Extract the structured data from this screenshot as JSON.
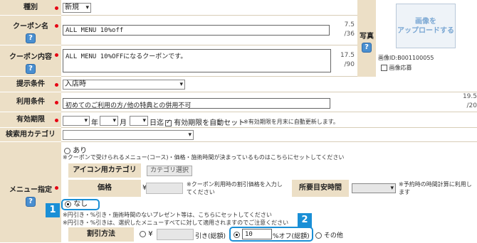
{
  "rows": {
    "type": {
      "label": "種別",
      "value": "新規"
    },
    "name": {
      "label": "クーポン名",
      "value": "ALL MENU 10%off",
      "count": "7.5",
      "max": "/36"
    },
    "content": {
      "label": "クーポン内容",
      "value": "ALL MENU 10%OFFになるクーポンです。",
      "count": "17.5",
      "max": "/90"
    },
    "condition": {
      "label": "提示条件",
      "value": "入店時"
    },
    "terms": {
      "label": "利用条件",
      "value": "初めてのご利用の方/他の特典との併用不可",
      "count": "19.5",
      "max": "/20"
    },
    "expiry": {
      "label": "有効期限",
      "year": "年",
      "month": "月",
      "day": "日迄",
      "auto_label": "有効期限を自動セット",
      "auto_note": "※有効期限を月末に自動更新します。"
    },
    "search_cat": {
      "label": "検索用カテゴリ"
    },
    "menu": {
      "label": "メニュー指定",
      "ari": "あり",
      "ari_note": "※クーポンで受けられるメニュー(コース)・価格・施術時間が決まっているものはこちらにセットしてください",
      "icon_cat_label": "アイコン用カテゴリ",
      "cat_btn": "カテゴリ選択",
      "price_label": "価格",
      "yen": "¥",
      "price_note": "※クーポン利用時の割引価格を入力してください",
      "time_label": "所要目安時間",
      "time_note": "※予約時の時間計算に利用します",
      "nashi": "なし",
      "nashi_note1": "※円引き・%引き・施術時間のないプレゼント等は、こちらにセットしてください",
      "nashi_note2": "※円引き・%引きは、選択したメニューすべてに対して適用されますのでご注意ください",
      "discount_label": "割引方法",
      "yen_off": "引き(総額)",
      "pct_value": "10",
      "pct_off": "%オフ(総額)",
      "other": "その他"
    }
  },
  "photo": {
    "label": "写真",
    "upload_btn": "画像を\nアップロードする",
    "image_id": "画像ID:B001100055",
    "apply": "画像応募"
  },
  "badges": {
    "one": "1",
    "two": "2"
  },
  "help_mark": "?"
}
